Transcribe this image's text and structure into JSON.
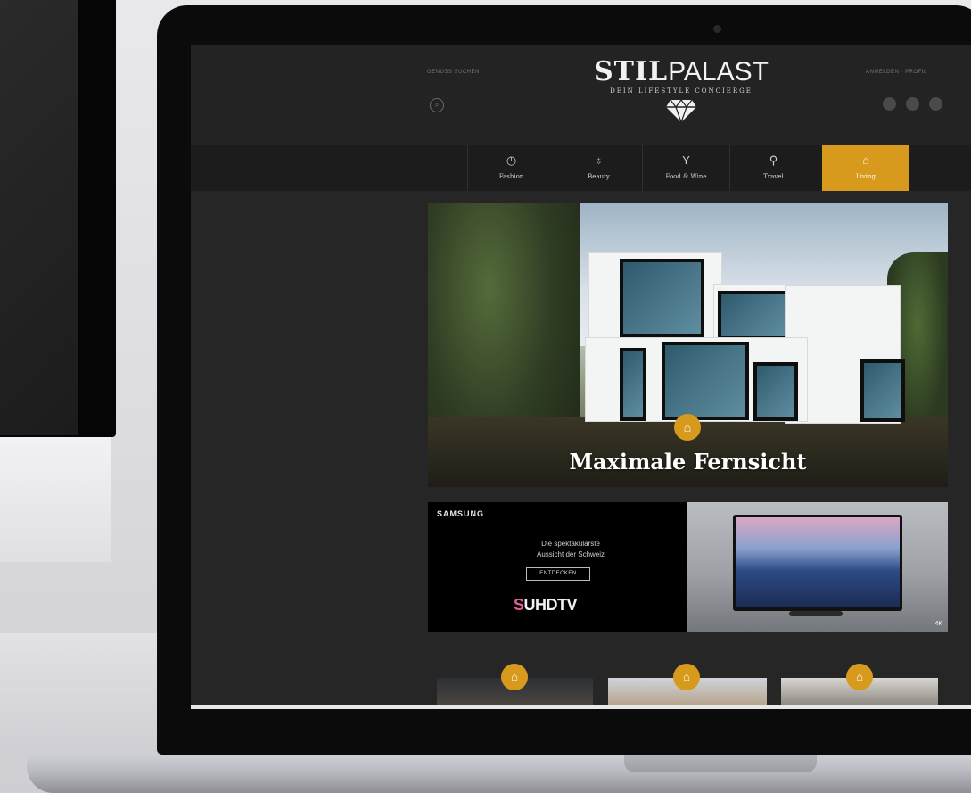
{
  "site": {
    "header_left_text": "GENUSS SUCHEN",
    "header_right_text": "ANMELDEN · PROFIL",
    "logo_bold": "STIL",
    "logo_thin": "PALAST",
    "tagline": "DEIN LIFESTYLE CONCIERGE",
    "diamond_icon": "diamond-icon",
    "search_icon": "search-icon"
  },
  "nav": {
    "items": [
      {
        "label": "Fashion",
        "icon": "clock-icon"
      },
      {
        "label": "Beauty",
        "icon": "bottle-icon"
      },
      {
        "label": "Food & Wine",
        "icon": "cocktail-icon"
      },
      {
        "label": "Travel",
        "icon": "pin-icon"
      },
      {
        "label": "Living",
        "icon": "home-icon"
      }
    ],
    "active_index": 4,
    "active_color": "#d79a1c"
  },
  "hero": {
    "title": "Maximale Fernsicht",
    "badge_icon": "home-icon"
  },
  "ad": {
    "brand": "SAMSUNG",
    "line1": "Die spektakulärste",
    "line2": "Aussicht der Schweiz",
    "button": "ENTDECKEN",
    "logo_letter": "S",
    "logo_rest": "UHDTV",
    "corner": "4K"
  },
  "colors": {
    "accent": "#d79a1c",
    "page_bg": "#262626",
    "header_bg": "#232323",
    "nav_bg": "#1c1c1c"
  }
}
